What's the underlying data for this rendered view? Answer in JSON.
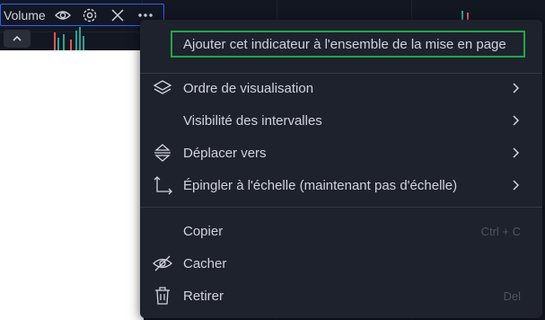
{
  "legend": {
    "title": "Volume",
    "icons": [
      "eye-icon",
      "gear-icon",
      "close-icon",
      "more-icon"
    ]
  },
  "collapse_button": {
    "icon": "chevron-up-icon"
  },
  "colors": {
    "background": "#131722",
    "menu_background": "#1e222d",
    "text": "#d1d4dc",
    "muted": "#50535e",
    "accent_blue": "#2962ff",
    "highlight_green": "#22a745",
    "bar_green": "#26a69a",
    "bar_red": "#ef5350"
  },
  "menu": {
    "add_to_layout": "Ajouter cet indicateur à l'ensemble de la mise en page",
    "visual_order": "Ordre de visualisation",
    "interval_visibility": "Visibilité des intervalles",
    "move_to": "Déplacer vers",
    "pin_to_scale": "Épingler à l'échelle (maintenant pas d'échelle)",
    "copy": "Copier",
    "copy_shortcut": "Ctrl + C",
    "hide": "Cacher",
    "remove": "Retirer",
    "remove_shortcut": "Del"
  }
}
